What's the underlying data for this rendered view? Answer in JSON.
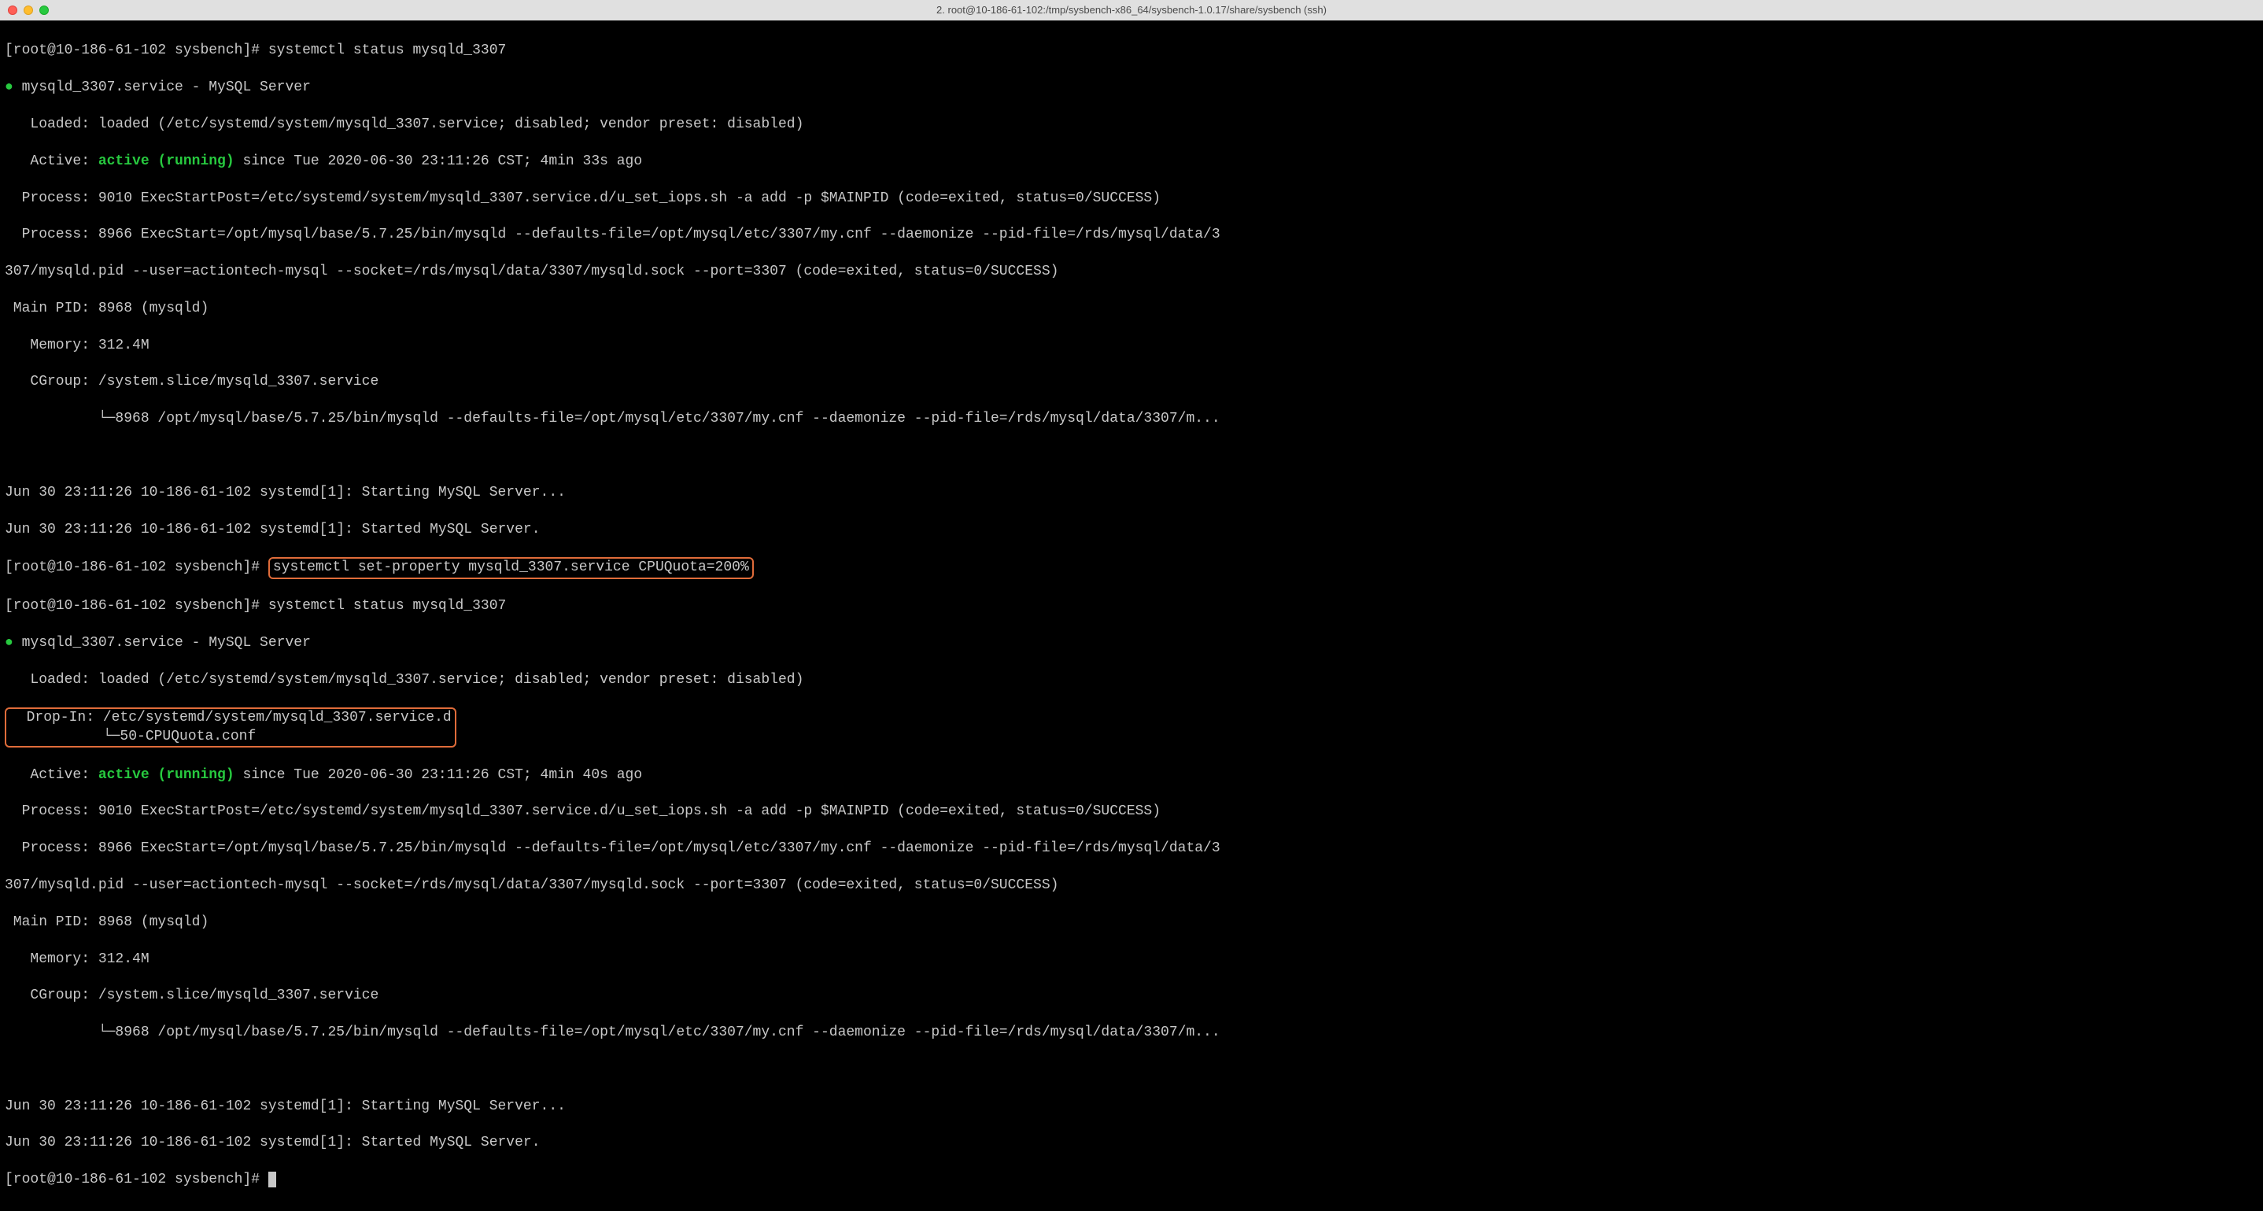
{
  "titlebar": {
    "title": "2. root@10-186-61-102:/tmp/sysbench-x86_64/sysbench-1.0.17/share/sysbench (ssh)"
  },
  "term": {
    "prompt": "[root@10-186-61-102 sysbench]# ",
    "cmd_status": "systemctl status mysqld_3307",
    "cmd_setprop": "systemctl set-property mysqld_3307.service CPUQuota=200%",
    "svc_header": "mysqld_3307.service - MySQL Server",
    "loaded": "   Loaded: loaded (/etc/systemd/system/mysqld_3307.service; disabled; vendor preset: disabled)",
    "dropin1": "  Drop-In: /etc/systemd/system/mysqld_3307.service.d",
    "dropin2": "           └─50-CPUQuota.conf",
    "active_label": "   Active: ",
    "active_value": "active (running)",
    "active_since_1": " since Tue 2020-06-30 23:11:26 CST; 4min 33s ago",
    "active_since_2": " since Tue 2020-06-30 23:11:26 CST; 4min 40s ago",
    "process1": "  Process: 9010 ExecStartPost=/etc/systemd/system/mysqld_3307.service.d/u_set_iops.sh -a add -p $MAINPID (code=exited, status=0/SUCCESS)",
    "process2a": "  Process: 8966 ExecStart=/opt/mysql/base/5.7.25/bin/mysqld --defaults-file=/opt/mysql/etc/3307/my.cnf --daemonize --pid-file=/rds/mysql/data/3",
    "process2b": "307/mysqld.pid --user=actiontech-mysql --socket=/rds/mysql/data/3307/mysqld.sock --port=3307 (code=exited, status=0/SUCCESS)",
    "mainpid": " Main PID: 8968 (mysqld)",
    "memory": "   Memory: 312.4M",
    "cgroup": "   CGroup: /system.slice/mysqld_3307.service",
    "cgroup2": "           └─8968 /opt/mysql/base/5.7.25/bin/mysqld --defaults-file=/opt/mysql/etc/3307/my.cnf --daemonize --pid-file=/rds/mysql/data/3307/m...",
    "log1": "Jun 30 23:11:26 10-186-61-102 systemd[1]: Starting MySQL Server...",
    "log2": "Jun 30 23:11:26 10-186-61-102 systemd[1]: Started MySQL Server."
  }
}
